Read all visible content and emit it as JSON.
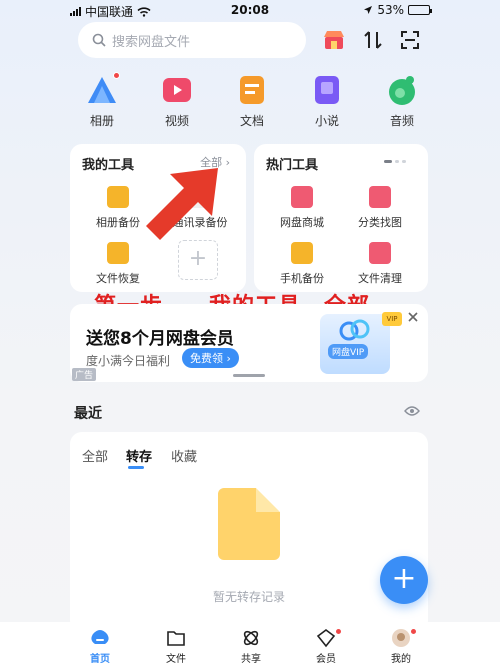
{
  "status_bar": {
    "carrier": "中国联通",
    "time": "20:08",
    "battery": "53%",
    "battery_level": 0.53
  },
  "header": {
    "search_placeholder": "搜索网盘文件",
    "icons": [
      "shop-icon",
      "transfer-icon",
      "scan-icon"
    ]
  },
  "categories": [
    {
      "label": "相册",
      "icon": "album-icon",
      "color": "#3f8cf6",
      "badge": true
    },
    {
      "label": "视频",
      "icon": "video-icon",
      "color": "#ef4a6a",
      "badge": false
    },
    {
      "label": "文档",
      "icon": "doc-icon",
      "color": "#f59a2a",
      "badge": false
    },
    {
      "label": "小说",
      "icon": "novel-icon",
      "color": "#7a5af5",
      "badge": false
    },
    {
      "label": "音频",
      "icon": "audio-icon",
      "color": "#2fbd72",
      "badge": false
    }
  ],
  "my_tools": {
    "title": "我的工具",
    "all_link": "全部",
    "items": [
      {
        "label": "相册备份",
        "color": "#f5b42a"
      },
      {
        "label": "通讯录备份",
        "color": "#f0f0f0"
      },
      {
        "label": "文件恢复",
        "color": "#f5b42a"
      }
    ]
  },
  "hot_tools": {
    "title": "热门工具",
    "items": [
      {
        "label": "网盘商城",
        "color": "#ef5a72"
      },
      {
        "label": "分类找图",
        "color": "#ef5a72"
      },
      {
        "label": "手机备份",
        "color": "#f5b42a"
      },
      {
        "label": "文件清理",
        "color": "#ef5a72"
      }
    ]
  },
  "annotation": "第一步——我的工具，全部",
  "banner": {
    "title": "送您8个月网盘会员",
    "subtitle": "度小满今日福利",
    "button": "免费领 ›",
    "ad_tag": "广告",
    "vip_label": "网盘VIP",
    "vip_badge": "VIP"
  },
  "recent": {
    "title": "最近",
    "tabs": [
      "全部",
      "转存",
      "收藏"
    ],
    "active_tab": 1,
    "empty_text": "暂无转存记录"
  },
  "tabbar": {
    "items": [
      {
        "label": "首页",
        "icon": "home-icon"
      },
      {
        "label": "文件",
        "icon": "folder-icon"
      },
      {
        "label": "共享",
        "icon": "share-icon"
      },
      {
        "label": "会员",
        "icon": "vip-icon"
      },
      {
        "label": "我的",
        "icon": "profile-icon"
      }
    ],
    "active": 0
  },
  "colors": {
    "accent": "#3a8ef6",
    "annotation": "#e02020"
  }
}
